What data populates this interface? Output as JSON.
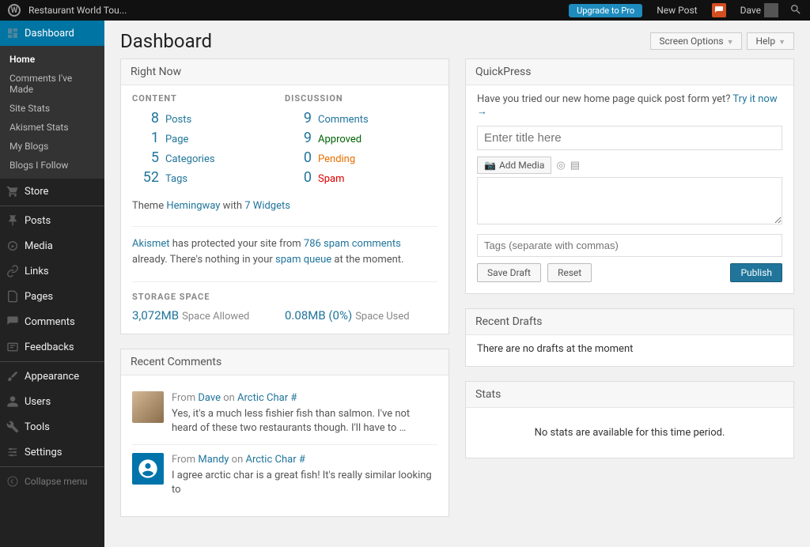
{
  "topbar": {
    "site_name": "Restaurant World Tou...",
    "upgrade": "Upgrade to Pro",
    "new_post": "New Post",
    "user": "Dave"
  },
  "page_title": "Dashboard",
  "options": {
    "screen": "Screen Options",
    "help": "Help"
  },
  "sidebar": {
    "dashboard": "Dashboard",
    "sub": [
      "Home",
      "Comments I've Made",
      "Site Stats",
      "Akismet Stats",
      "My Blogs",
      "Blogs I Follow"
    ],
    "items": [
      "Store",
      "Posts",
      "Media",
      "Links",
      "Pages",
      "Comments",
      "Feedbacks",
      "Appearance",
      "Users",
      "Tools",
      "Settings"
    ],
    "collapse": "Collapse menu"
  },
  "right_now": {
    "title": "Right Now",
    "content_h": "CONTENT",
    "discussion_h": "DISCUSSION",
    "content": [
      {
        "n": "8",
        "l": "Posts"
      },
      {
        "n": "1",
        "l": "Page"
      },
      {
        "n": "5",
        "l": "Categories"
      },
      {
        "n": "52",
        "l": "Tags"
      }
    ],
    "discussion": [
      {
        "n": "9",
        "l": "Comments",
        "cls": ""
      },
      {
        "n": "9",
        "l": "Approved",
        "cls": "approved"
      },
      {
        "n": "0",
        "l": "Pending",
        "cls": "pending"
      },
      {
        "n": "0",
        "l": "Spam",
        "cls": "spam"
      }
    ],
    "theme_pre": "Theme ",
    "theme": "Hemingway",
    "theme_mid": " with ",
    "widgets": "7 Widgets",
    "akismet_a": "Akismet",
    "akismet_1": " has protected your site from ",
    "akismet_count": "786 spam comments",
    "akismet_2": " already. There's nothing in your ",
    "akismet_queue": "spam queue",
    "akismet_3": " at the moment.",
    "storage_h": "STORAGE SPACE",
    "storage_allowed": "3,072MB",
    "storage_allowed_l": "Space Allowed",
    "storage_used": "0.08MB (0%)",
    "storage_used_l": "Space Used"
  },
  "quickpress": {
    "title": "QuickPress",
    "prompt": "Have you tried our new home page quick post form yet? ",
    "try": "Try it now →",
    "title_ph": "Enter title here",
    "add_media": "Add Media",
    "tags_ph": "Tags (separate with commas)",
    "save": "Save Draft",
    "reset": "Reset",
    "publish": "Publish"
  },
  "recent_drafts": {
    "title": "Recent Drafts",
    "empty": "There are no drafts at the moment"
  },
  "stats": {
    "title": "Stats",
    "empty": "No stats are available for this time period."
  },
  "recent_comments": {
    "title": "Recent Comments",
    "items": [
      {
        "from": "From ",
        "author": "Dave",
        "on": " on ",
        "post": "Arctic Char #",
        "text": "Yes, it's a much less fishier fish than salmon. I've not heard of these two restaurants though. I'll have to …",
        "avatar": "photo"
      },
      {
        "from": "From ",
        "author": "Mandy",
        "on": " on ",
        "post": "Arctic Char #",
        "text": "I agree arctic char is a great fish! It's really similar looking to",
        "avatar": "blue"
      }
    ]
  }
}
